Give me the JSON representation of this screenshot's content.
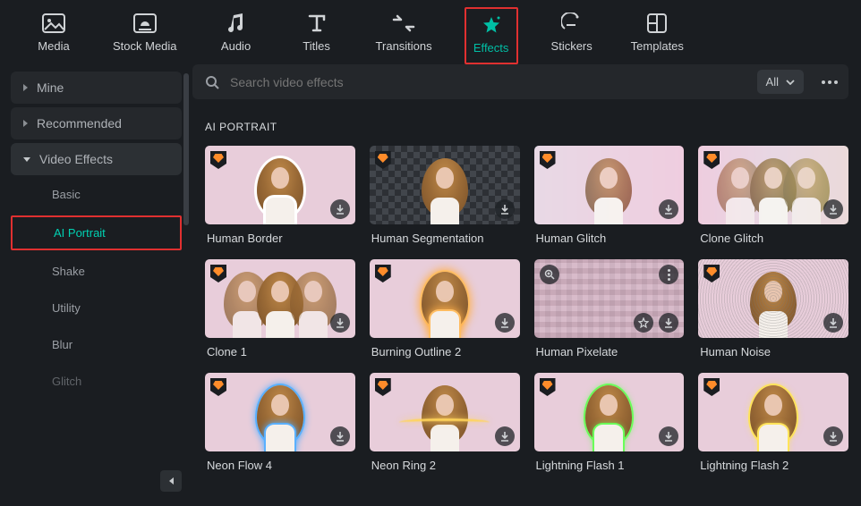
{
  "topnav": {
    "items": [
      {
        "label": "Media"
      },
      {
        "label": "Stock Media"
      },
      {
        "label": "Audio"
      },
      {
        "label": "Titles"
      },
      {
        "label": "Transitions"
      },
      {
        "label": "Effects"
      },
      {
        "label": "Stickers"
      },
      {
        "label": "Templates"
      }
    ]
  },
  "sidebar": {
    "items": [
      {
        "label": "Mine"
      },
      {
        "label": "Recommended"
      },
      {
        "label": "Video Effects"
      }
    ],
    "subitems": [
      {
        "label": "Basic"
      },
      {
        "label": "AI Portrait"
      },
      {
        "label": "Shake"
      },
      {
        "label": "Utility"
      },
      {
        "label": "Blur"
      },
      {
        "label": "Glitch"
      }
    ]
  },
  "search": {
    "placeholder": "Search video effects"
  },
  "filter": {
    "label": "All"
  },
  "section": {
    "title": "AI PORTRAIT"
  },
  "effects": [
    {
      "label": "Human Border"
    },
    {
      "label": "Human Segmentation"
    },
    {
      "label": "Human Glitch"
    },
    {
      "label": "Clone Glitch"
    },
    {
      "label": "Clone 1"
    },
    {
      "label": "Burning Outline 2"
    },
    {
      "label": "Human Pixelate"
    },
    {
      "label": "Human Noise"
    },
    {
      "label": "Neon Flow 4"
    },
    {
      "label": "Neon Ring 2"
    },
    {
      "label": "Lightning Flash 1"
    },
    {
      "label": "Lightning Flash 2"
    }
  ]
}
